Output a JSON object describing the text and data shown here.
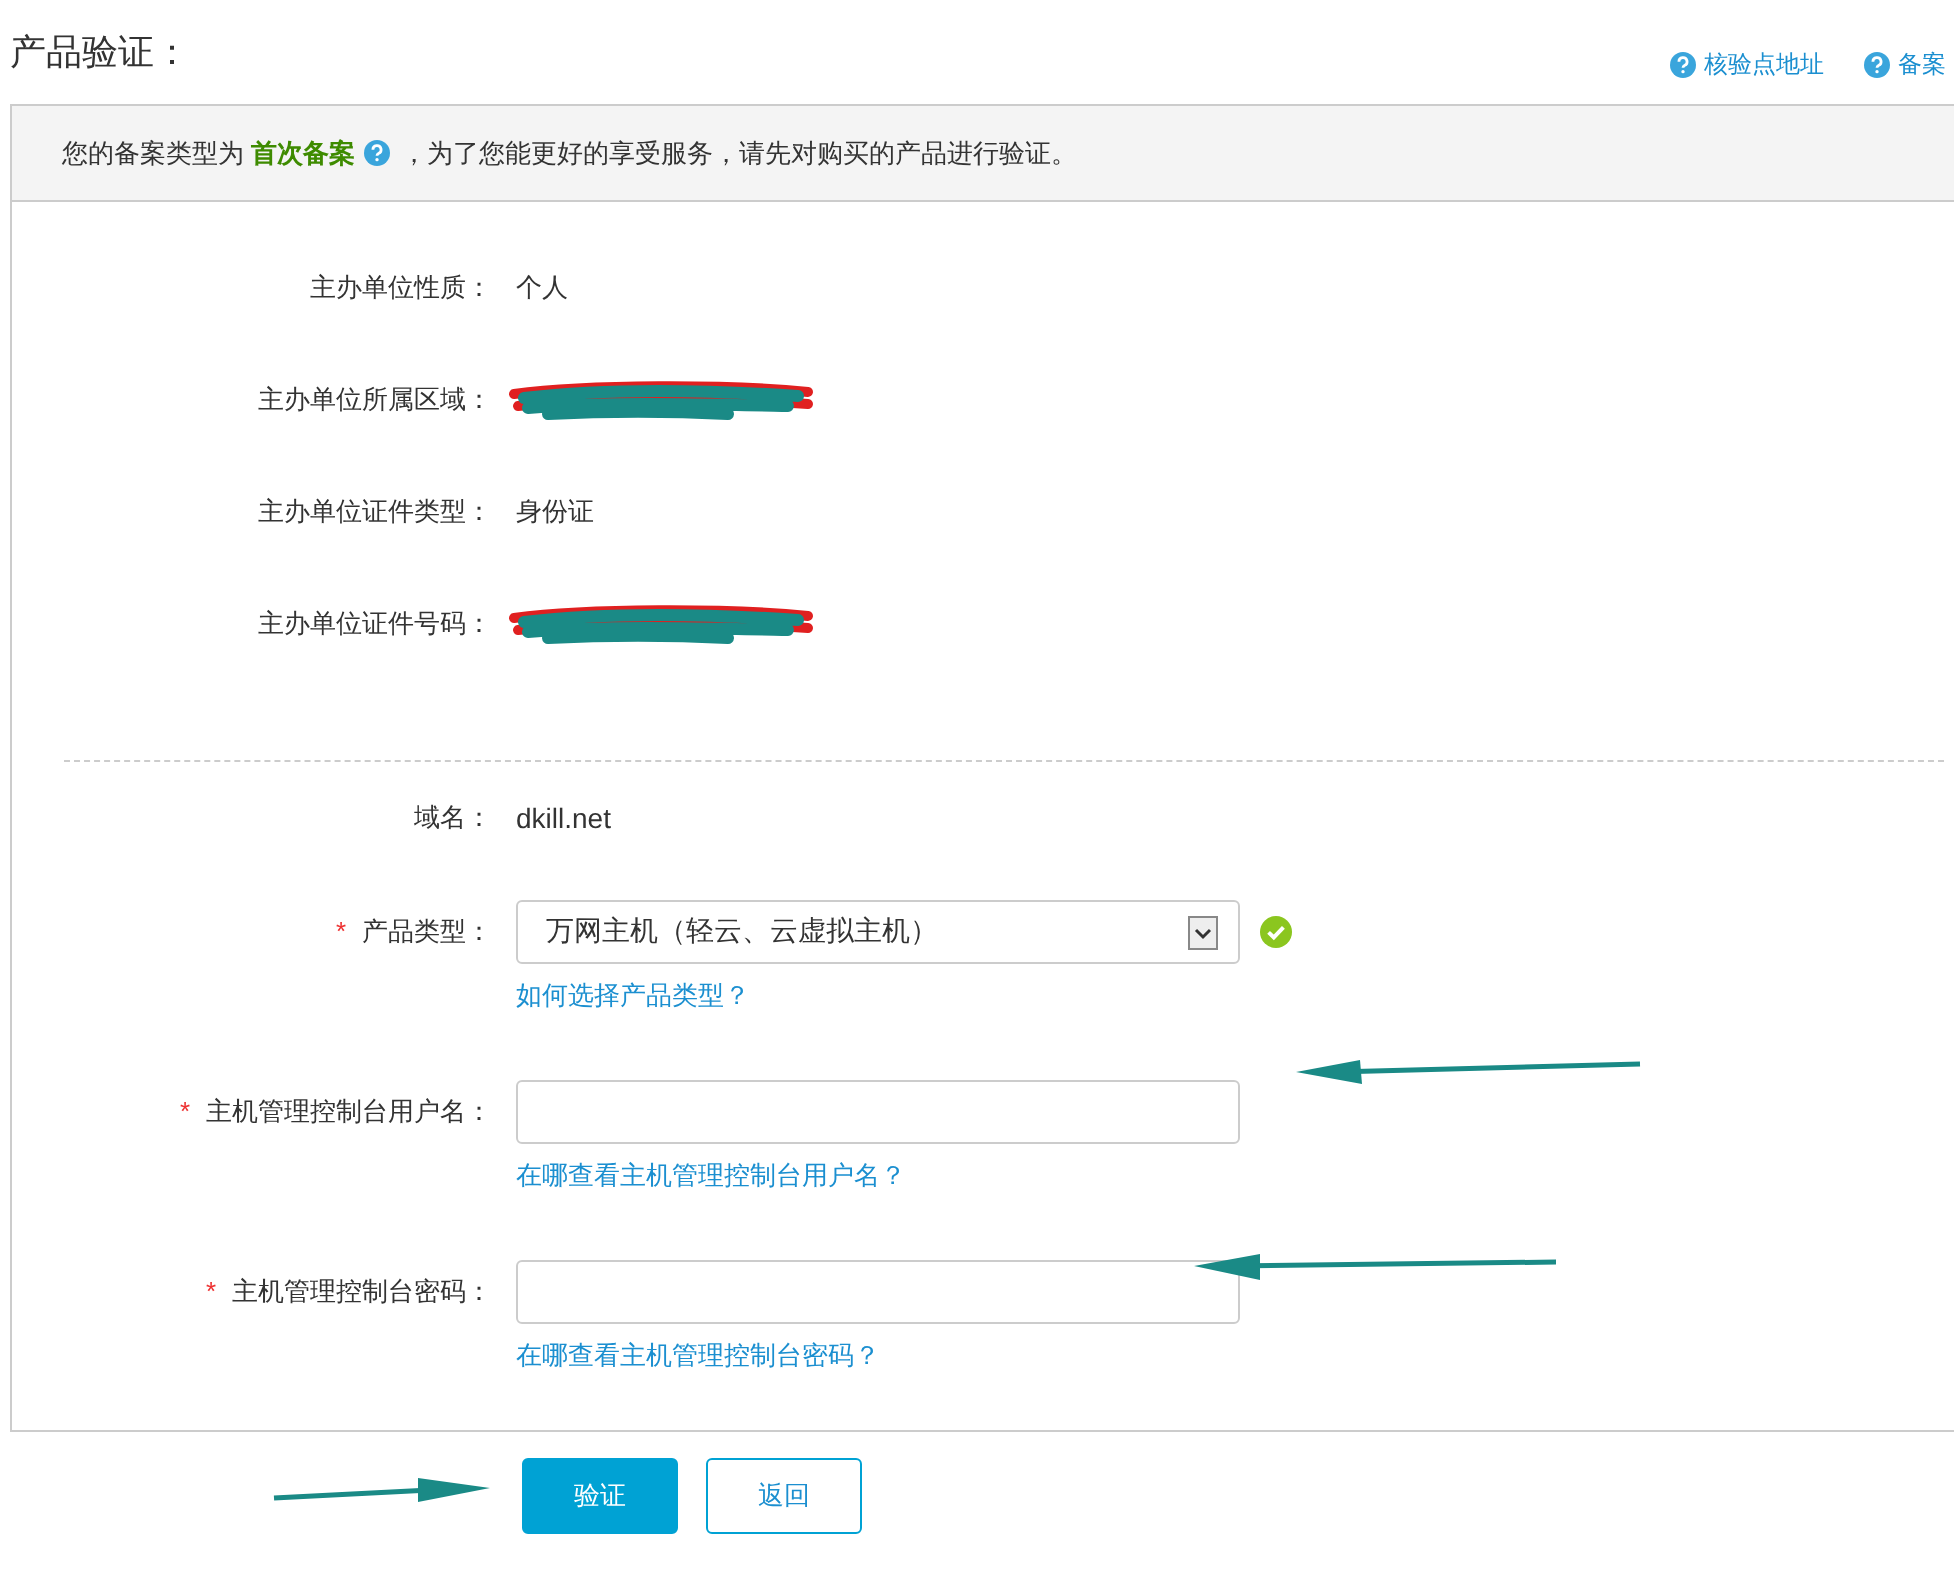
{
  "title": "产品验证：",
  "help_links": [
    {
      "label": "核验点地址"
    },
    {
      "label": "备案"
    }
  ],
  "notice": {
    "before": "您的备案类型为",
    "highlight": "首次备案",
    "after": "，为了您能更好的享受服务，请先对购买的产品进行验证。"
  },
  "info_rows": [
    {
      "kind": "text",
      "label": "主办单位性质：",
      "value": "个人"
    },
    {
      "kind": "redacted",
      "label": "主办单位所属区域："
    },
    {
      "kind": "text",
      "label": "主办单位证件类型：",
      "value": "身份证"
    },
    {
      "kind": "redacted",
      "label": "主办单位证件号码："
    }
  ],
  "domain": {
    "label": "域名：",
    "value": "dkill.net"
  },
  "fields": [
    {
      "kind": "select",
      "required_mark": "*",
      "label": "产品类型：",
      "value": "万网主机（轻云、云虚拟主机）",
      "valid": true,
      "help": "如何选择产品类型？"
    },
    {
      "kind": "input",
      "required_mark": "*",
      "label": "主机管理控制台用户名：",
      "valid": false,
      "help": "在哪查看主机管理控制台用户名？"
    },
    {
      "kind": "input",
      "required_mark": "*",
      "label": "主机管理控制台密码：",
      "valid": false,
      "help": "在哪查看主机管理控制台密码？"
    }
  ],
  "buttons": [
    {
      "kind": "primary",
      "label": "验证"
    },
    {
      "kind": "secondary",
      "label": "返回"
    }
  ]
}
